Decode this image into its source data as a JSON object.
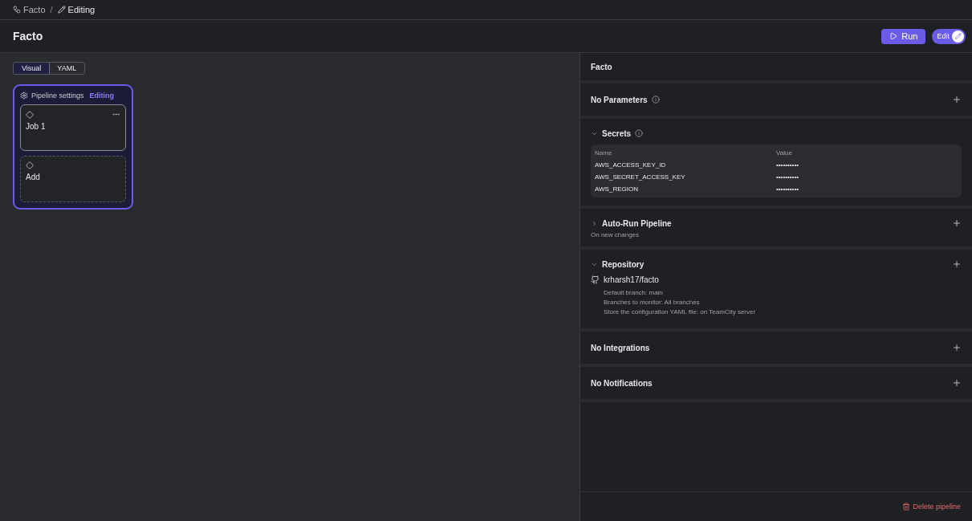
{
  "breadcrumbs": [
    {
      "label": "Facto"
    },
    {
      "label": "Editing"
    }
  ],
  "breadcrumb_separator": "/",
  "header": {
    "title": "Facto",
    "run_button": "Run",
    "edit_toggle": {
      "label": "Edit",
      "on": true
    }
  },
  "view_tabs": [
    {
      "label": "Visual",
      "selected": true
    },
    {
      "label": "YAML",
      "selected": false
    }
  ],
  "pipeline": {
    "settings_label": "Pipeline settings",
    "status": "Editing",
    "jobs": [
      {
        "kind": "job",
        "label": "Job 1"
      },
      {
        "kind": "add",
        "label": "Add"
      }
    ]
  },
  "panel": {
    "title": "Facto",
    "sections": [
      {
        "kind": "plain",
        "title": "No Parameters",
        "info": true
      },
      {
        "kind": "secrets",
        "title": "Secrets",
        "info": true,
        "expanded": true,
        "columns": [
          "Name",
          "Value"
        ],
        "rows": [
          [
            "AWS_ACCESS_KEY_ID",
            "••••••••••"
          ],
          [
            "AWS_SECRET_ACCESS_KEY",
            "••••••••••"
          ],
          [
            "AWS_REGION",
            "••••••••••"
          ]
        ]
      },
      {
        "kind": "collapsible",
        "title": "Auto-Run Pipeline",
        "expanded": false,
        "subtitle": "On new changes"
      },
      {
        "kind": "repository",
        "title": "Repository",
        "expanded": true,
        "repo": "krharsh17/facto",
        "details": [
          "Default branch: main",
          "Branches to monitor: All branches",
          "Store the configuration YAML file: on TeamCity server"
        ]
      },
      {
        "kind": "plain",
        "title": "No Integrations",
        "info": false
      },
      {
        "kind": "plain",
        "title": "No Notifications",
        "info": false
      }
    ],
    "delete_button": "Delete pipeline"
  }
}
